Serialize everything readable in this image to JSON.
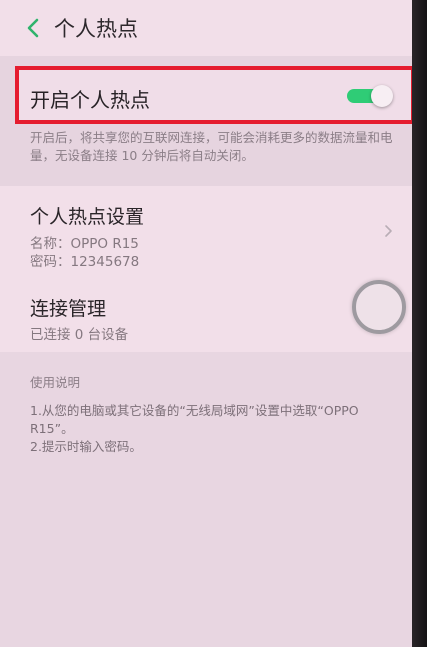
{
  "header": {
    "title": "个人热点",
    "back_icon": "chevron-left-icon"
  },
  "hotspot_toggle": {
    "label": "开启个人热点",
    "state": "on",
    "accent_color": "#2fcc76",
    "highlight_color": "#e51c2f"
  },
  "description": "开启后，将共享您的互联网连接，可能会消耗更多的数据流量和电量，无设备连接 10 分钟后将自动关闭。",
  "hotspot_settings": {
    "title": "个人热点设置",
    "name_line": "名称：OPPO R15",
    "password_line": "密码：12345678"
  },
  "connection_management": {
    "title": "连接管理",
    "status": "已连接 0 台设备"
  },
  "instructions": {
    "title": "使用说明",
    "step1": "1.从您的电脑或其它设备的“无线局域网”设置中选取“OPPO R15”。",
    "step2": "2.提示时输入密码。"
  }
}
